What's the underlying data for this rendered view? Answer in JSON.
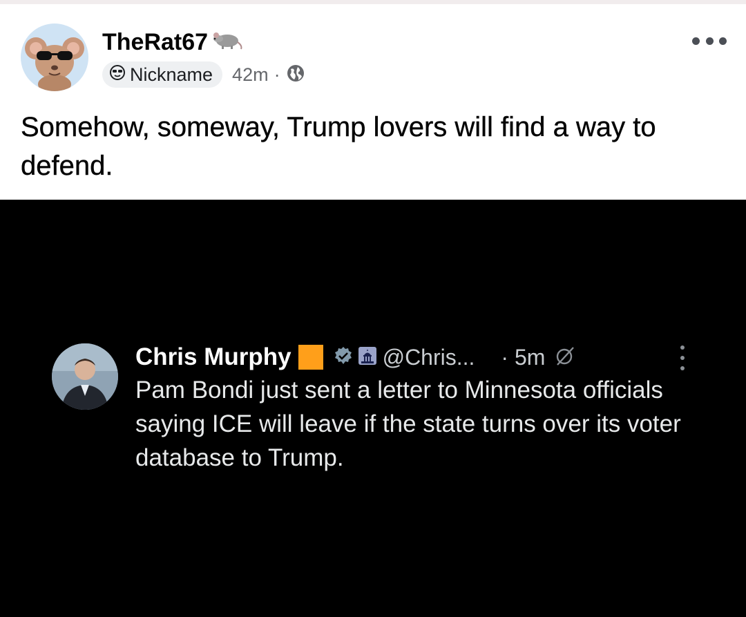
{
  "post": {
    "author": "TheRat67",
    "author_emoji": "rat-icon",
    "nickname_label": "Nickname",
    "time": "42m",
    "separator": "·",
    "privacy_icon": "globe-icon",
    "text": "Somehow, someway, Trump lovers will find a way to defend."
  },
  "tweet": {
    "author_name": "Chris Murphy",
    "handle": "@Chris...",
    "time": "· 5m",
    "text": "Pam Bondi just sent a letter to Minnesota officials saying ICE will leave if the state turns over its voter database to Trump.",
    "badge_colors": {
      "square": "#ff9f1a"
    }
  },
  "colors": {
    "post_background": "#ffffff",
    "tweet_background": "#000000",
    "chip_background": "#eef0f2"
  }
}
